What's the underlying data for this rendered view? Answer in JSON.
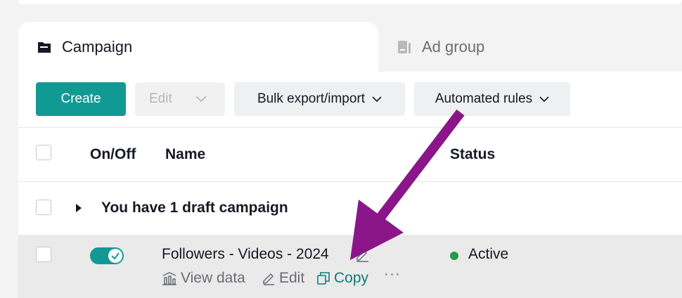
{
  "tabs": [
    {
      "label": "Campaign",
      "icon": "folder-icon",
      "active": true
    },
    {
      "label": "Ad group",
      "icon": "ad-group-icon",
      "active": false
    }
  ],
  "toolbar": {
    "create_label": "Create",
    "edit_label": "Edit",
    "bulk_label": "Bulk export/import",
    "automated_label": "Automated rules"
  },
  "table": {
    "headers": {
      "onoff": "On/Off",
      "name": "Name",
      "status": "Status"
    },
    "draft_row": "You have 1 draft campaign",
    "rows": [
      {
        "name": "Followers - Videos - 2024",
        "status": "Active",
        "toggle_on": true,
        "actions": {
          "view": "View data",
          "edit": "Edit",
          "copy": "Copy",
          "more": "···"
        }
      }
    ]
  },
  "colors": {
    "accent": "#119a93",
    "status_active": "#1f9e44",
    "annotation_arrow": "#8a1689"
  }
}
